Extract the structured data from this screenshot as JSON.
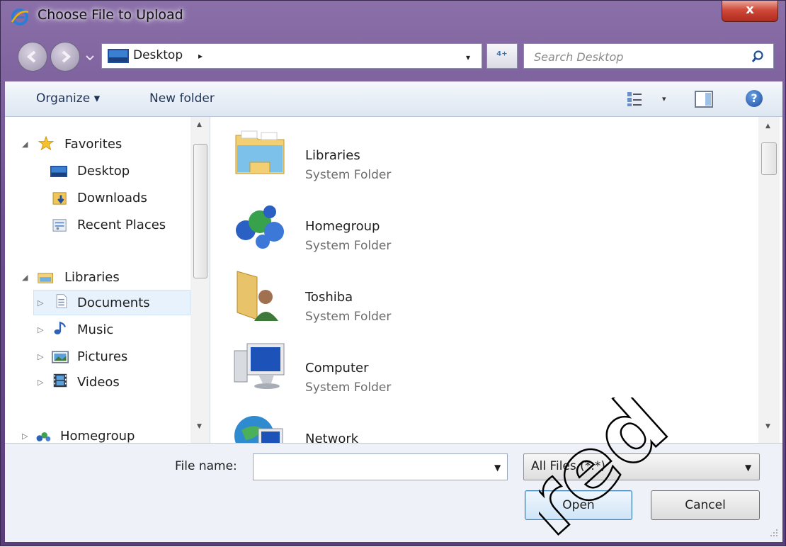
{
  "window": {
    "title": "Choose File to Upload",
    "close_glyph": "x"
  },
  "address": {
    "location": "Desktop",
    "separator": "▸",
    "dropdown_glyph": "▾",
    "refresh_glyph": "⁴⁺"
  },
  "search": {
    "placeholder": "Search Desktop"
  },
  "toolbar": {
    "organize_label": "Organize ▾",
    "new_folder_label": "New folder",
    "view_dropdown_glyph": "▾",
    "help_glyph": "?"
  },
  "nav": {
    "favorites_label": "Favorites",
    "favorites_items": [
      {
        "label": "Desktop",
        "icon": "desktop-icon"
      },
      {
        "label": "Downloads",
        "icon": "downloads-icon"
      },
      {
        "label": "Recent Places",
        "icon": "recent-places-icon"
      }
    ],
    "libraries_label": "Libraries",
    "libraries_items": [
      {
        "label": "Documents",
        "icon": "documents-icon",
        "selected": true
      },
      {
        "label": "Music",
        "icon": "music-icon"
      },
      {
        "label": "Pictures",
        "icon": "pictures-icon"
      },
      {
        "label": "Videos",
        "icon": "videos-icon"
      }
    ],
    "homegroup_label": "Homegroup"
  },
  "files": [
    {
      "name": "Libraries",
      "type": "System Folder",
      "icon": "libraries-folder-icon"
    },
    {
      "name": "Homegroup",
      "type": "System Folder",
      "icon": "homegroup-icon"
    },
    {
      "name": "Toshiba",
      "type": "System Folder",
      "icon": "user-folder-icon"
    },
    {
      "name": "Computer",
      "type": "System Folder",
      "icon": "computer-icon"
    },
    {
      "name": "Network",
      "type": "",
      "icon": "network-icon"
    }
  ],
  "bottom": {
    "file_name_label": "File name:",
    "file_name_value": "",
    "filter_value": "All Files (*.*)",
    "open_label": "Open",
    "cancel_label": "Cancel"
  },
  "watermark": {
    "text": "...red"
  },
  "colors": {
    "title_gradient": "#6d4f8f",
    "close_red": "#c7392b",
    "toolbar_blue": "#dde6f1",
    "selected_bg": "#e8f2fc"
  }
}
